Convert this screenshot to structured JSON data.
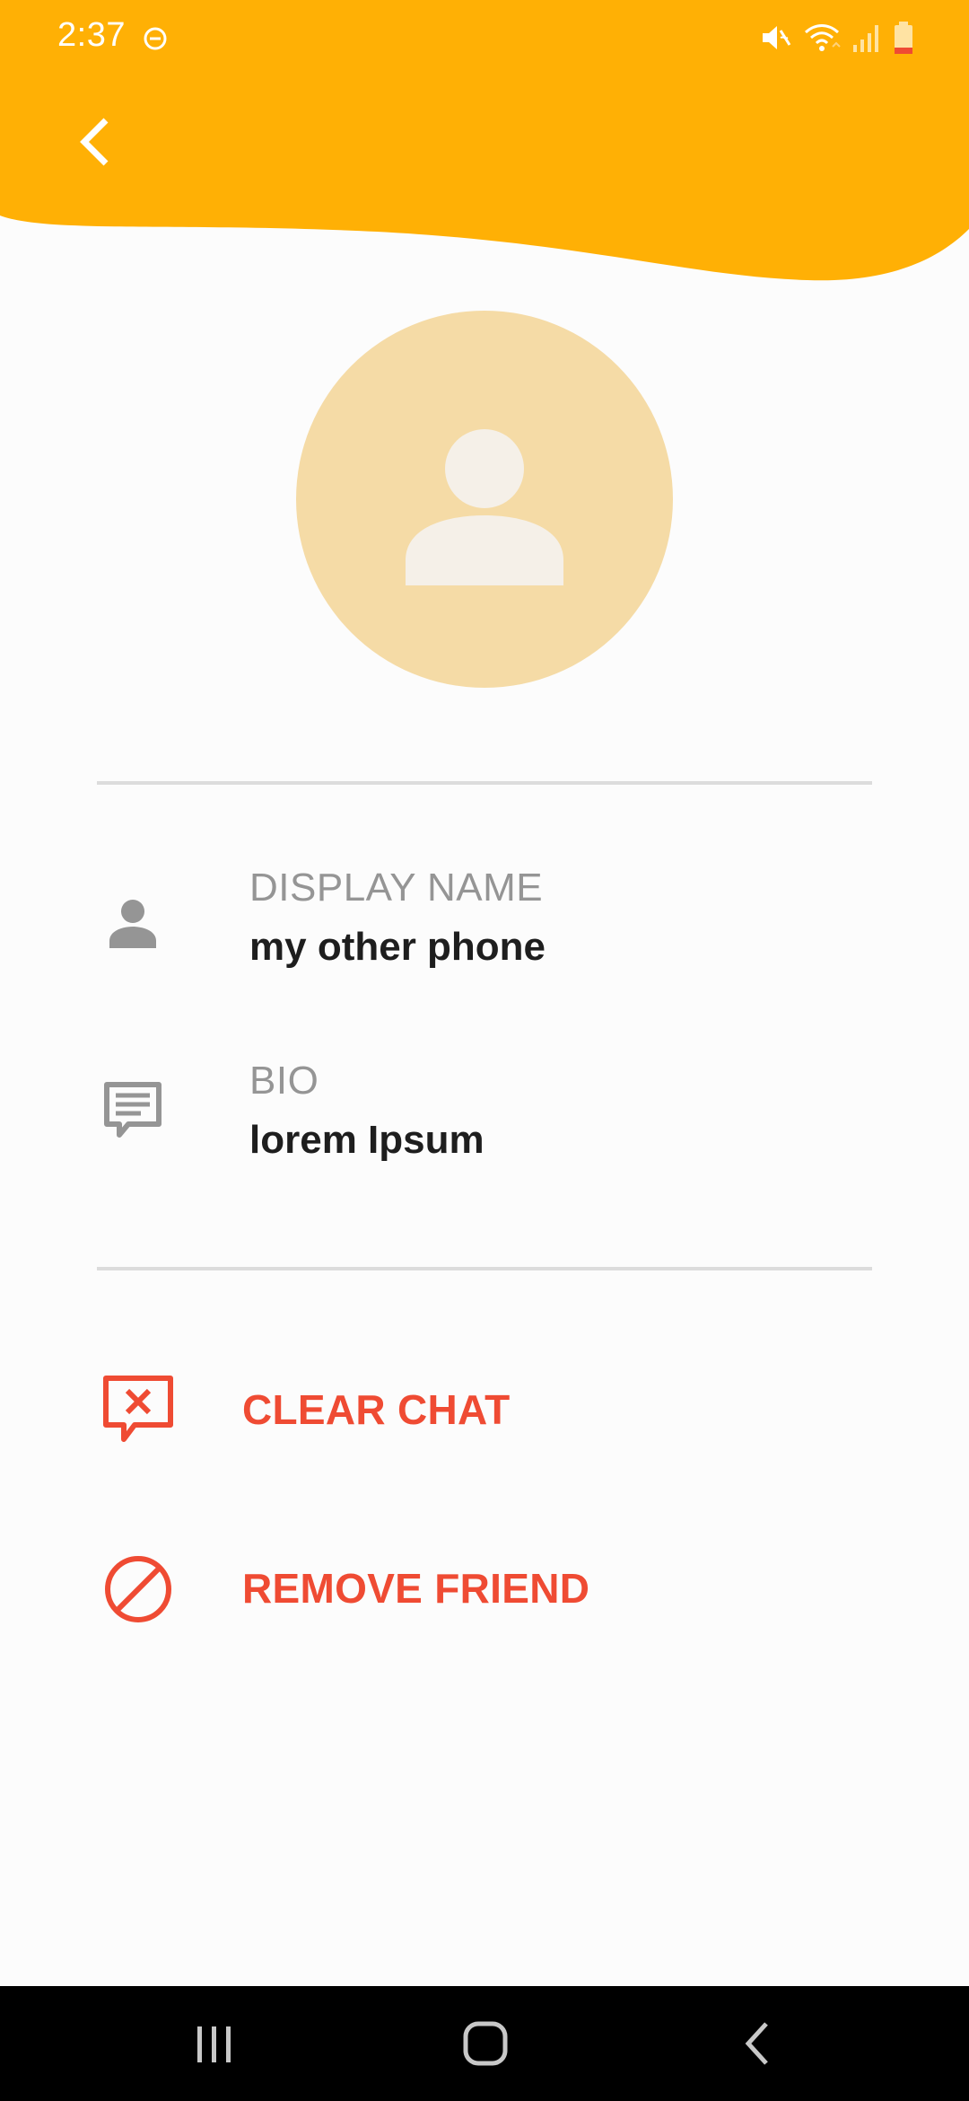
{
  "status_bar": {
    "time": "2:37",
    "icons": [
      "do-not-disturb-icon",
      "mute-icon",
      "wifi-icon",
      "signal-icon",
      "battery-low-icon"
    ]
  },
  "header": {
    "back_icon": "chevron-left-icon",
    "accent_color": "#ffb005"
  },
  "profile": {
    "avatar_icon": "person-icon",
    "avatar_bg_color": "#f5dba6"
  },
  "info": {
    "display_name": {
      "icon": "person-icon",
      "label": "DISPLAY NAME",
      "value": "my other phone"
    },
    "bio": {
      "icon": "message-icon",
      "label": "BIO",
      "value": "lorem Ipsum"
    }
  },
  "actions": {
    "clear_chat": {
      "icon": "chat-clear-icon",
      "label": "CLEAR CHAT"
    },
    "remove_friend": {
      "icon": "block-icon",
      "label": "REMOVE FRIEND"
    },
    "danger_color": "#ef4b33"
  },
  "nav_bar": {
    "recents_icon": "recents-icon",
    "home_icon": "home-icon",
    "back_icon": "back-icon"
  }
}
